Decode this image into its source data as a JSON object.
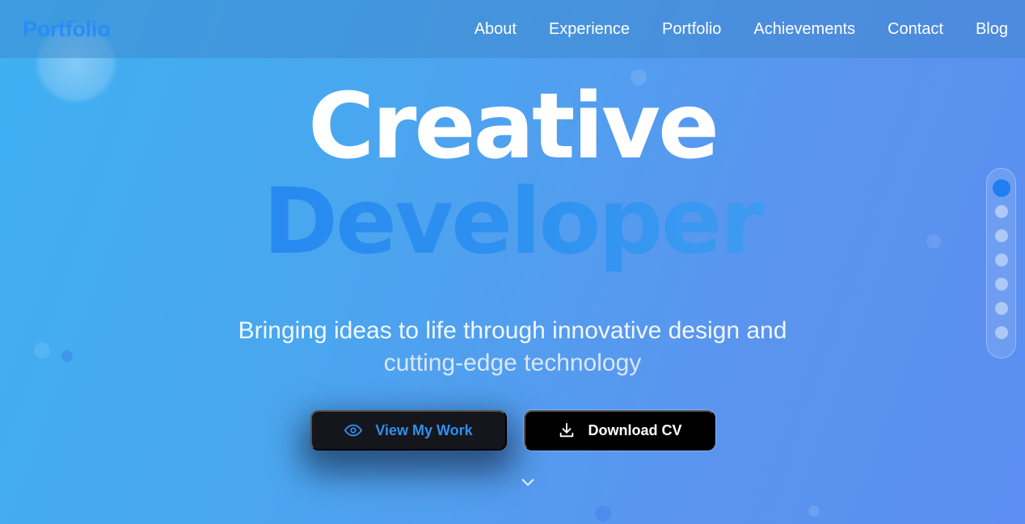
{
  "brand": {
    "name": "Portfolio"
  },
  "nav": {
    "items": [
      {
        "label": "About"
      },
      {
        "label": "Experience"
      },
      {
        "label": "Portfolio"
      },
      {
        "label": "Achievements"
      },
      {
        "label": "Contact"
      },
      {
        "label": "Blog"
      }
    ]
  },
  "hero": {
    "title_line1": "Creative",
    "title_line2": "Developer",
    "subtitle_line1": "Bringing ideas to life through innovative design and",
    "subtitle_line2": "cutting-edge technology"
  },
  "buttons": {
    "view_work": {
      "label": "View My Work",
      "icon": "eye-icon"
    },
    "download_cv": {
      "label": "Download CV",
      "icon": "download-icon"
    }
  },
  "scroll": {
    "icon": "chevron-down-icon"
  },
  "section_nav": {
    "count": 7,
    "active_index": 0
  },
  "colors": {
    "accent": "#1f7ff0",
    "brand_text": "#2a8cf5",
    "button_dark": "#15161c",
    "button_black": "#000000"
  }
}
